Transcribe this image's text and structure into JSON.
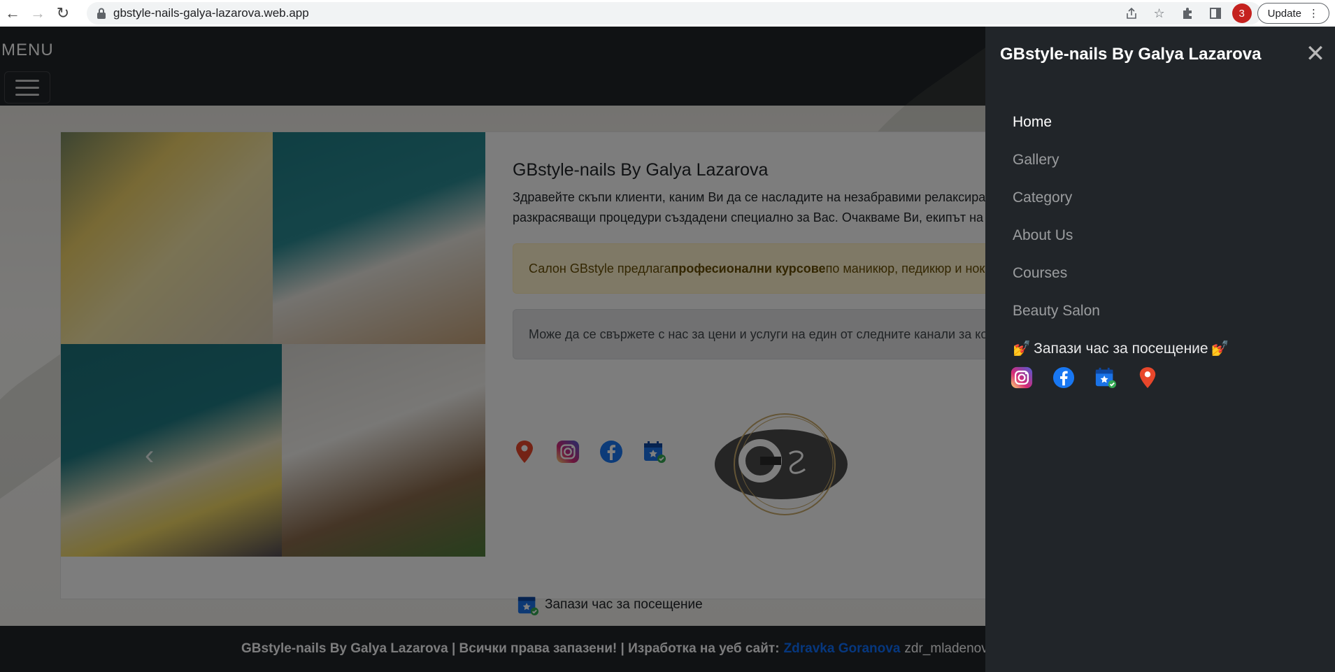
{
  "browser": {
    "url": "gbstyle-nails-galya-lazarova.web.app",
    "profile_badge": "3",
    "update_label": "Update"
  },
  "topbar": {
    "menu_label": "MENU"
  },
  "main": {
    "title": "GBstyle-nails By Galya Lazarova",
    "intro": "Здравейте скъпи клиенти, каним Ви да се насладите на незабравими релаксиращи и разкрасяващи процедури създадени специално за Вас. Очакваме Ви, екипът на GBstyle-nails By Galya Lazarova.",
    "courses_alert_before": "Салон GBstyle предлага ",
    "courses_alert_bold": "професионални курсове",
    "courses_alert_after": " по маникюр, педикюр и ноктопластика.",
    "contact_alert": "Може да се свържете с нас за цени и услуги на един от следните канали за комуникация:",
    "booking_label": "Запази час за посещение"
  },
  "footer": {
    "text_bold": "GBstyle-nails By Galya Lazarova | Всички права запазени! | Изработка на уеб сайт:",
    "author": "Zdravka Goranova",
    "handle": "zdr_mladenova"
  },
  "offcanvas": {
    "title": "GBstyle-nails By Galya Lazarova",
    "nav": [
      {
        "label": "Home"
      },
      {
        "label": "Gallery"
      },
      {
        "label": "Category"
      },
      {
        "label": "About Us"
      },
      {
        "label": "Courses"
      },
      {
        "label": "Beauty Salon"
      }
    ],
    "booking_label": "Запази час за посещение"
  },
  "icons": {
    "social": [
      "instagram-icon",
      "facebook-icon",
      "calendar-booking-icon",
      "map-pin-icon"
    ],
    "colors": {
      "instagram": "#d62976",
      "facebook": "#1877f2",
      "calendar": "#1a73e8",
      "map_pin": "#e8472b",
      "nav_active": "#ffffff"
    }
  }
}
